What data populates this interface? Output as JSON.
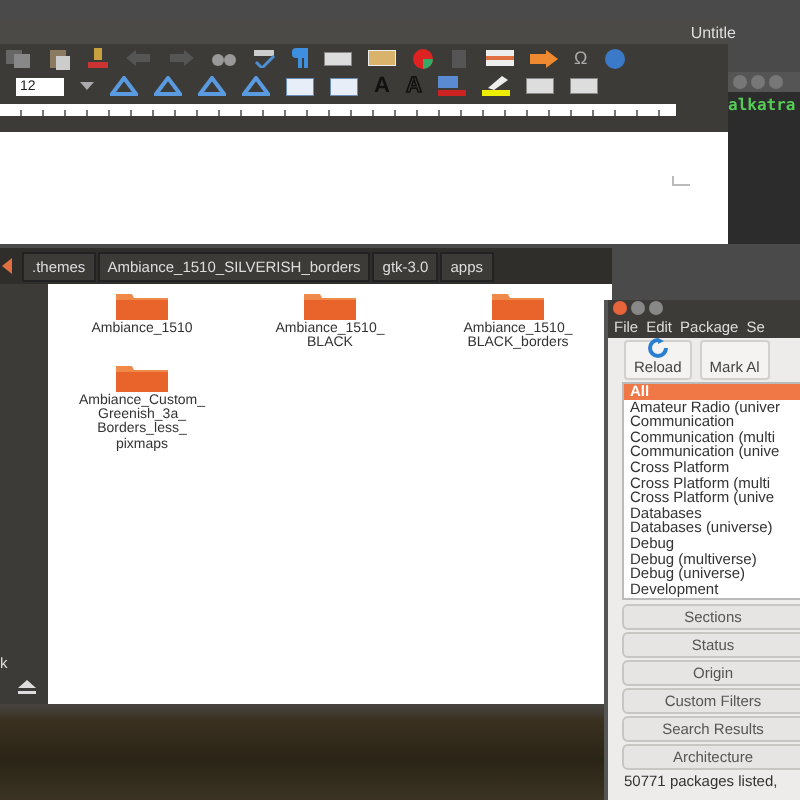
{
  "writer": {
    "title": "Untitle",
    "font_size": "12",
    "special_char": "Ω",
    "format_buttons": [
      {
        "label": "A",
        "kind": "bold"
      },
      {
        "label": "A",
        "kind": "outline"
      }
    ]
  },
  "terminal": {
    "text": "alkatra"
  },
  "files": {
    "breadcrumbs": [
      ".themes",
      "Ambiance_1510_SILVERISH_borders",
      "gtk-3.0",
      "apps"
    ],
    "sidebar_label": "k",
    "folders": [
      {
        "name": "Ambiance_1510"
      },
      {
        "name": "Ambiance_1510_\nBLACK"
      },
      {
        "name": "Ambiance_1510_\nBLACK_borders"
      },
      {
        "name": "Ambiance_Custom_\nGreenish_3a_\nBorders_less_\npixmaps"
      }
    ]
  },
  "synaptic": {
    "menu": [
      "File",
      "Edit",
      "Package",
      "Se"
    ],
    "toolbar": [
      {
        "label": "Reload",
        "kind": "reload"
      },
      {
        "label": "Mark Al",
        "kind": "mark"
      }
    ],
    "categories": [
      {
        "label": "All",
        "selected": true
      },
      {
        "label": "Amateur Radio (univer",
        "selected": false
      },
      {
        "label": "Communication",
        "selected": false
      },
      {
        "label": "Communication (multi",
        "selected": false
      },
      {
        "label": "Communication (unive",
        "selected": false
      },
      {
        "label": "Cross Platform",
        "selected": false
      },
      {
        "label": "Cross Platform (multi",
        "selected": false
      },
      {
        "label": "Cross Platform (unive",
        "selected": false
      },
      {
        "label": "Databases",
        "selected": false
      },
      {
        "label": "Databases (universe)",
        "selected": false
      },
      {
        "label": "Debug",
        "selected": false
      },
      {
        "label": "Debug (multiverse)",
        "selected": false
      },
      {
        "label": "Debug (universe)",
        "selected": false
      },
      {
        "label": "Development",
        "selected": false
      }
    ],
    "filter_buttons": [
      "Sections",
      "Status",
      "Origin",
      "Custom Filters",
      "Search Results",
      "Architecture"
    ],
    "status": "50771 packages listed,"
  }
}
